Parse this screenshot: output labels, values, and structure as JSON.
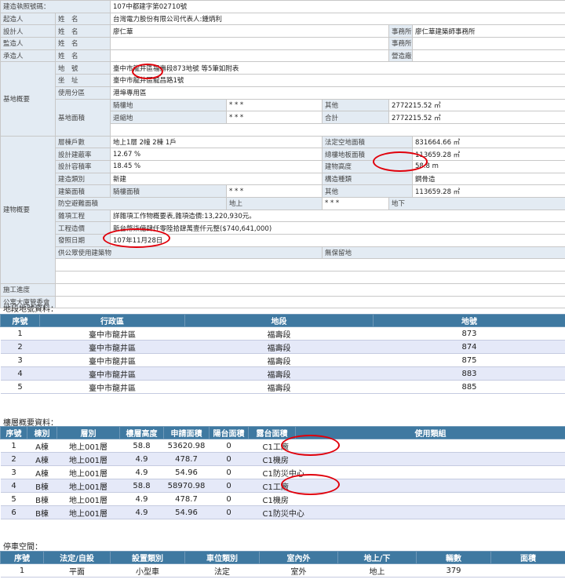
{
  "permit": {
    "rows": [
      [
        {
          "t": "建造執照號碼：",
          "c": 2,
          "k": "lab"
        },
        {
          "t": "107中都建字第02710號",
          "c": 5
        }
      ],
      [
        {
          "t": "起造人",
          "k": "lab"
        },
        {
          "t": "姓　名",
          "k": "lab"
        },
        {
          "t": "台灣電力股份有限公司代表人:鍾炳利",
          "c": 5
        }
      ],
      [
        {
          "t": "設計人",
          "k": "lab"
        },
        {
          "t": "姓　名",
          "k": "lab"
        },
        {
          "t": "廖仁華",
          "c": 3
        },
        {
          "t": "事務所",
          "k": "lab"
        },
        {
          "t": "廖仁華建築師事務所"
        }
      ],
      [
        {
          "t": "監造人",
          "k": "lab"
        },
        {
          "t": "姓　名",
          "k": "lab"
        },
        {
          "t": "",
          "c": 3
        },
        {
          "t": "事務所",
          "k": "lab"
        },
        {
          "t": ""
        }
      ],
      [
        {
          "t": "承造人",
          "k": "lab"
        },
        {
          "t": "姓　名",
          "k": "lab"
        },
        {
          "t": "",
          "c": 3
        },
        {
          "t": "營造廠",
          "k": "lab"
        },
        {
          "t": ""
        }
      ],
      [
        {
          "t": "基地概要",
          "k": "sec",
          "r": 6
        },
        {
          "t": "地　號",
          "k": "lab"
        },
        {
          "t": "臺中市龍井區福壽段873地號 等5筆如附表",
          "c": 5
        }
      ],
      [
        {
          "t": "坐　址",
          "k": "lab"
        },
        {
          "t": "臺中市龍井區龍昌路1號",
          "c": 5
        }
      ],
      [
        {
          "t": "使用分區",
          "k": "lab"
        },
        {
          "t": "港埠專用區",
          "c": 5
        }
      ],
      [
        {
          "t": "基地面積",
          "k": "lab",
          "r": 3
        },
        {
          "t": "騎樓地",
          "k": "lab"
        },
        {
          "t": "* * *"
        },
        {
          "t": "其他",
          "k": "lab"
        },
        {
          "t": "2772215.52 ㎡",
          "c": 2
        }
      ],
      [
        {
          "t": "退縮地",
          "k": "lab"
        },
        {
          "t": "* * *"
        },
        {
          "t": "合計",
          "k": "lab"
        },
        {
          "t": "2772215.52 ㎡",
          "c": 2
        }
      ],
      [
        {
          "t": "",
          "k": "blank",
          "c": 5
        }
      ],
      [
        {
          "t": "建物概要",
          "k": "sec",
          "r": 12
        },
        {
          "t": "層棟戶數",
          "k": "lab"
        },
        {
          "t": "地上1層 2幢 2棟 1戶",
          "c": 2
        },
        {
          "t": "法定空地面積",
          "k": "lab",
          "c": 2
        },
        {
          "t": "831664.66 ㎡"
        }
      ],
      [
        {
          "t": "設計建蔽率",
          "k": "lab"
        },
        {
          "t": "12.67 %",
          "c": 2
        },
        {
          "t": "總樓地板面積",
          "k": "lab",
          "c": 2
        },
        {
          "t": "113659.28 ㎡"
        }
      ],
      [
        {
          "t": "設計容積率",
          "k": "lab"
        },
        {
          "t": "18.45 %",
          "c": 2
        },
        {
          "t": "建物高度",
          "k": "lab",
          "c": 2
        },
        {
          "t": "58.8 m"
        }
      ],
      [
        {
          "t": "建造類別",
          "k": "lab"
        },
        {
          "t": "新建",
          "c": 2
        },
        {
          "t": "構造種類",
          "k": "lab",
          "c": 2
        },
        {
          "t": "鋼骨造"
        }
      ],
      [
        {
          "t": "建築面積",
          "k": "lab"
        },
        {
          "t": "騎樓面積",
          "k": "lab"
        },
        {
          "t": "* * *"
        },
        {
          "t": "其他",
          "k": "lab",
          "c": 2
        },
        {
          "t": "113659.28 ㎡"
        }
      ],
      [
        {
          "t": "防空避難面積",
          "k": "lab",
          "c": 2
        },
        {
          "t": "地上",
          "k": "lab"
        },
        {
          "t": "* * *"
        },
        {
          "t": "地下",
          "k": "lab",
          "c": 2
        },
        {
          "t": "* * *"
        }
      ],
      [
        {
          "t": "雜項工程",
          "k": "lab"
        },
        {
          "t": "詳雜項工作物概要表,雜項造價:13,220,930元。",
          "c": 5
        }
      ],
      [
        {
          "t": "工程造價",
          "k": "lab"
        },
        {
          "t": "新台幣柒億肆仟零陸拾肆萬壹仟元整($740,641,000)",
          "c": 5
        }
      ],
      [
        {
          "t": "發照日期",
          "k": "lab"
        },
        {
          "t": "107年11月28日",
          "c": 5
        }
      ],
      [
        {
          "t": "供公眾使用建築物",
          "k": "lab",
          "c": 3
        },
        {
          "t": "無保留地",
          "k": "lab",
          "c": 3
        }
      ],
      [
        {
          "t": "",
          "k": "blank",
          "c": 6
        }
      ],
      [
        {
          "t": "",
          "k": "blank",
          "c": 6
        }
      ],
      [
        {
          "t": "施工進度",
          "k": "lab"
        },
        {
          "t": "",
          "c": 6
        }
      ],
      [
        {
          "t": "公寓大廈管委會",
          "k": "lab"
        },
        {
          "t": "",
          "c": 6
        }
      ]
    ]
  },
  "land": {
    "title": "地段地號資料：",
    "headers": [
      "序號",
      "行政區",
      "地段",
      "地號"
    ],
    "rows": [
      [
        "1",
        "臺中市龍井區",
        "福壽段",
        "873"
      ],
      [
        "2",
        "臺中市龍井區",
        "福壽段",
        "874"
      ],
      [
        "3",
        "臺中市龍井區",
        "福壽段",
        "875"
      ],
      [
        "4",
        "臺中市龍井區",
        "福壽段",
        "883"
      ],
      [
        "5",
        "臺中市龍井區",
        "福壽段",
        "885"
      ]
    ]
  },
  "floors": {
    "title": "樓層概要資料：",
    "headers": [
      "序號",
      "棟別",
      "層別",
      "樓層高度",
      "申請面積",
      "陽台面積",
      "露台面積",
      "使用類組"
    ],
    "rows": [
      [
        "1",
        "A棟",
        "地上001層",
        "58.8",
        "53620.98",
        "0",
        "C1工廠"
      ],
      [
        "2",
        "A棟",
        "地上001層",
        "4.9",
        "478.7",
        "0",
        "C1機房"
      ],
      [
        "3",
        "A棟",
        "地上001層",
        "4.9",
        "54.96",
        "0",
        "C1防災中心"
      ],
      [
        "4",
        "B棟",
        "地上001層",
        "58.8",
        "58970.98",
        "0",
        "C1工廠"
      ],
      [
        "5",
        "B棟",
        "地上001層",
        "4.9",
        "478.7",
        "0",
        "C1機房"
      ],
      [
        "6",
        "B棟",
        "地上001層",
        "4.9",
        "54.96",
        "0",
        "C1防災中心"
      ]
    ]
  },
  "parking": {
    "title": "停車空間：",
    "headers": [
      "序號",
      "法定/自設",
      "設置類別",
      "車位類別",
      "室內外",
      "地上/下",
      "輛數",
      "面積"
    ],
    "rows": [
      [
        "1",
        "平面",
        "小型車",
        "法定",
        "室外",
        "地上",
        "379",
        ""
      ]
    ]
  },
  "colors": {
    "header_blue": "#3f79a1",
    "label_bg": "#e3ebf3",
    "row_alt": "#e5e9f8",
    "highlight": "#e0000b"
  }
}
